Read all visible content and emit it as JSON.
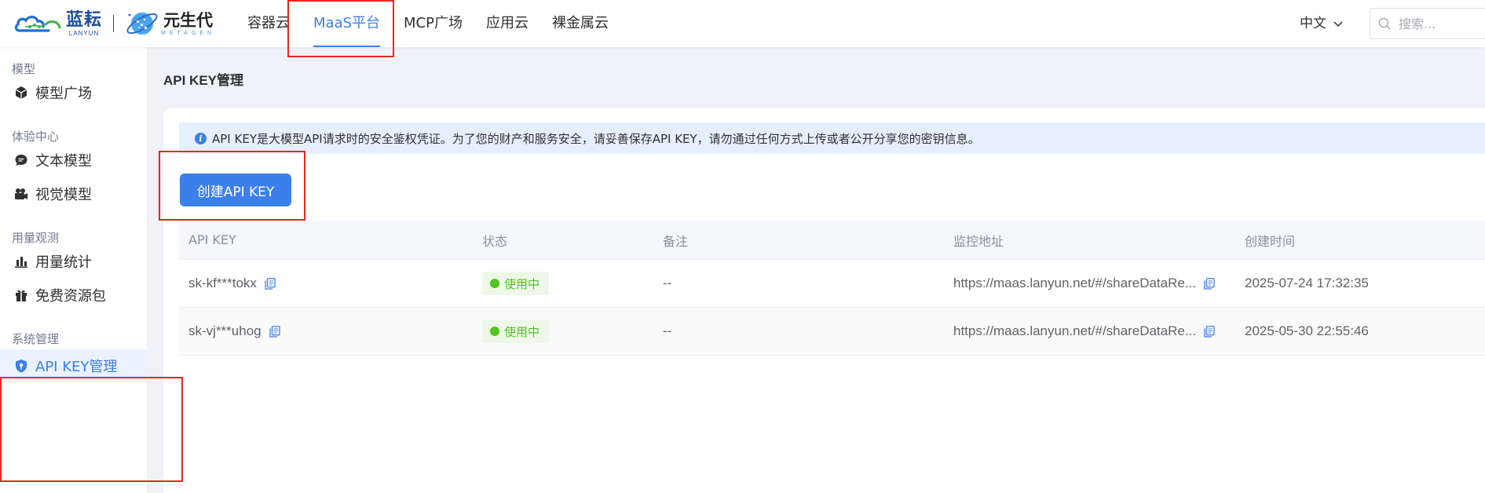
{
  "header": {
    "logo_primary_cn": "蓝耘",
    "logo_primary_en": "LANYUN",
    "logo_secondary_cn": "元生代",
    "logo_secondary_en": "METAGEN",
    "nav": [
      {
        "label": "容器云"
      },
      {
        "label": "MaaS平台"
      },
      {
        "label": "MCP广场"
      },
      {
        "label": "应用云"
      },
      {
        "label": "裸金属云"
      }
    ],
    "active_nav": "MaaS平台",
    "language": "中文",
    "search_placeholder": "搜索..."
  },
  "sidebar": {
    "groups": [
      {
        "title": "模型",
        "items": [
          {
            "label": "模型广场",
            "icon": "cube-icon"
          }
        ]
      },
      {
        "title": "体验中心",
        "items": [
          {
            "label": "文本模型",
            "icon": "chat-bubble-icon"
          },
          {
            "label": "视觉模型",
            "icon": "video-camera-icon"
          }
        ]
      },
      {
        "title": "用量观测",
        "items": [
          {
            "label": "用量统计",
            "icon": "bar-chart-icon"
          },
          {
            "label": "免费资源包",
            "icon": "gift-icon"
          }
        ]
      },
      {
        "title": "系统管理",
        "items": [
          {
            "label": "API KEY管理",
            "icon": "shield-key-icon"
          }
        ]
      }
    ],
    "active_item": "API KEY管理"
  },
  "main": {
    "page_title": "API KEY管理",
    "alert_text": "API KEY是大模型API请求时的安全鉴权凭证。为了您的财产和服务安全，请妥善保存API KEY，请勿通过任何方式上传或者公开分享您的密钥信息。",
    "create_button": "创建API KEY",
    "table": {
      "columns": [
        "API KEY",
        "状态",
        "备注",
        "监控地址",
        "创建时间"
      ],
      "rows": [
        {
          "api_key": "sk-kf***tokx",
          "status": "使用中",
          "remark": "--",
          "monitor_url": "https://maas.lanyun.net/#/shareDataRe...",
          "created_at": "2025-07-24 17:32:35"
        },
        {
          "api_key": "sk-vj***uhog",
          "status": "使用中",
          "remark": "--",
          "monitor_url": "https://maas.lanyun.net/#/shareDataRe...",
          "created_at": "2025-05-30 22:55:46"
        }
      ]
    }
  },
  "colors": {
    "accent": "#3d7fea",
    "status_green": "#52c41a",
    "annotation_red": "#e8281e",
    "main_bg": "#f0f2f8"
  }
}
